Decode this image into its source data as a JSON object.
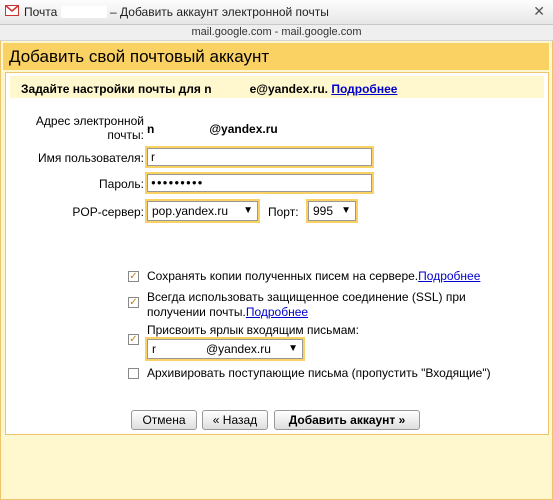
{
  "window": {
    "title_prefix": "Почта",
    "title_suffix": "– Добавить аккаунт электронной почты",
    "url": "mail.google.com - mail.google.com",
    "close_label": "✕"
  },
  "dialog": {
    "heading": "Добавить свой почтовый аккаунт",
    "subtitle_prefix": "Задайте настройки почты для n",
    "subtitle_suffix": "e@yandex.ru.",
    "subtitle_link": "Подробнее"
  },
  "form": {
    "email_label": "Адрес электронной почты:",
    "email_prefix": "n",
    "email_suffix": "@yandex.ru",
    "username_label": "Имя пользователя:",
    "username_value": "r",
    "password_label": "Пароль:",
    "password_value": "●●●●●●●●●",
    "pop_label": "POP-сервер:",
    "pop_value": "pop.yandex.ru",
    "port_label": "Порт:",
    "port_value": "995"
  },
  "options": [
    {
      "label": "Сохранять копии полученных писем на сервере.",
      "link": "Подробнее",
      "checked": true
    },
    {
      "label": "Всегда использовать защищенное соединение (SSL) при получении почты.",
      "link": "Подробнее",
      "checked": true
    },
    {
      "label": "Присвоить ярлык входящим письмам:",
      "checked": true,
      "select_prefix": "r",
      "select_suffix": "@yandex.ru"
    },
    {
      "label": "Архивировать поступающие письма (пропустить \"Входящие\")",
      "checked": false
    }
  ],
  "buttons": {
    "cancel": "Отмена",
    "back": "« Назад",
    "add": "Добавить аккаунт »"
  },
  "colors": {
    "header": "#fad163",
    "background": "#fff8cf",
    "link": "#0000cc"
  }
}
